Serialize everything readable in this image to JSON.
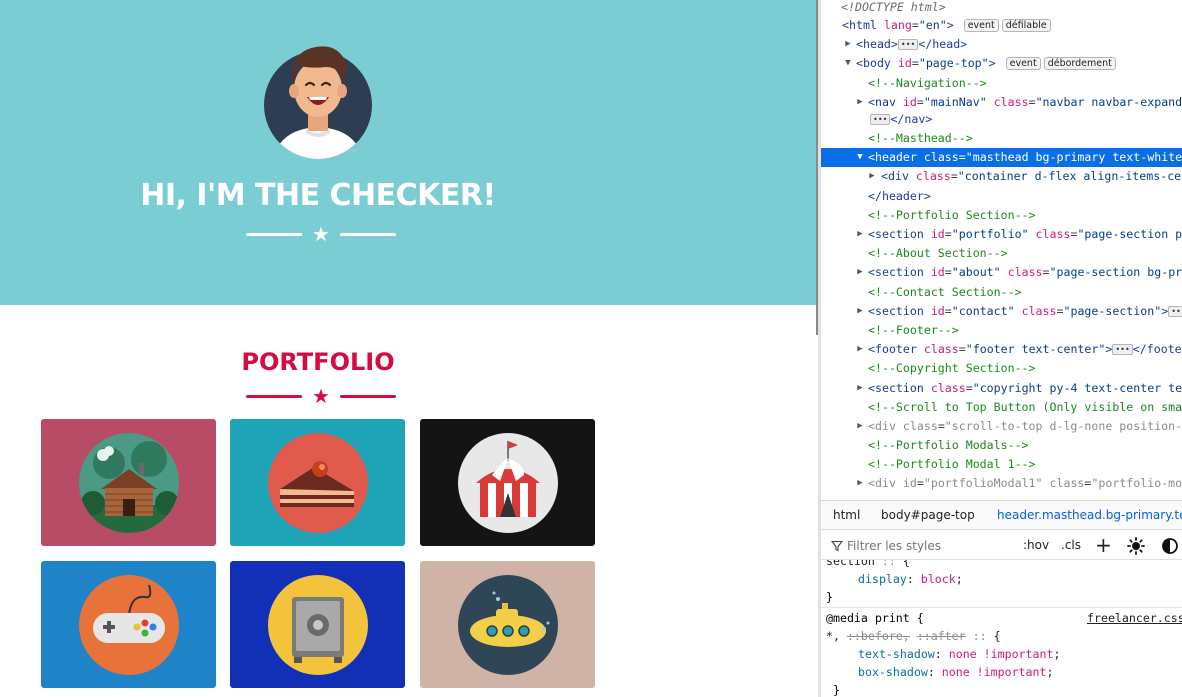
{
  "page": {
    "masthead_title": "HI, I'M THE CHECKER!",
    "portfolio_title": "PORTFOLIO",
    "colors": {
      "masthead": "#7bcdd4",
      "accent": "#d50b43"
    },
    "tiles": [
      {
        "name": "cabin",
        "bg": "#b84b65",
        "icon": "cabin-icon"
      },
      {
        "name": "cake",
        "bg": "#1fa3b7",
        "icon": "cake-icon"
      },
      {
        "name": "circus",
        "bg": "#141414",
        "icon": "circus-tent-icon"
      },
      {
        "name": "game",
        "bg": "#1f84c7",
        "icon": "game-controller-icon"
      },
      {
        "name": "safe",
        "bg": "#1230b5",
        "icon": "safe-icon"
      },
      {
        "name": "submarine",
        "bg": "#ceb3a6",
        "icon": "submarine-icon"
      }
    ]
  },
  "devtools": {
    "tree": {
      "doctype": "<!DOCTYPE html>",
      "html_open": "<html",
      "lang_attr": "lang",
      "lang_val": "\"en\"",
      "gt": ">",
      "badge_event": "event",
      "badge_scrollable": "défilable",
      "head_open": "<head>",
      "head_close": "</head>",
      "body_open": "<body",
      "body_id_attr": "id",
      "body_id_val": "\"page-top\"",
      "badge_overflow": "débordement",
      "c_nav": "<!--Navigation-->",
      "nav_open": "<nav",
      "nav_id_attr": "id",
      "nav_id_val": "\"mainNav\"",
      "nav_class_attr": "class",
      "nav_class_val": "\"navbar navbar-expand",
      "nav_close": "</nav>",
      "c_masthead": "<!--Masthead-->",
      "header_open": "<header",
      "header_class_attr": "class",
      "header_class_val": "\"masthead bg-primary text-white",
      "div_open": "<div",
      "div_class_attr": "class",
      "div_class_val": "\"container d-flex align-items-ce",
      "header_close": "</header>",
      "c_portfolio": "<!--Portfolio Section-->",
      "sec1_open": "<section",
      "sec1_id_attr": "id",
      "sec1_id_val": "\"portfolio\"",
      "sec1_class_attr": "class",
      "sec1_class_val": "\"page-section p",
      "c_about": "<!--About Section-->",
      "sec2_open": "<section",
      "sec2_id_attr": "id",
      "sec2_id_val": "\"about\"",
      "sec2_class_attr": "class",
      "sec2_class_val": "\"page-section bg-pr",
      "c_contact": "<!--Contact Section-->",
      "sec3_open": "<section",
      "sec3_id_attr": "id",
      "sec3_id_val": "\"contact\"",
      "sec3_class_attr": "class",
      "sec3_class_val": "\"page-section\"",
      "c_footer": "<!--Footer-->",
      "footer_open": "<footer",
      "footer_class_attr": "class",
      "footer_class_val": "\"footer text-center\"",
      "footer_close": "</foote",
      "c_copyright": "<!--Copyright Section-->",
      "sec4_open": "<section",
      "sec4_class_attr": "class",
      "sec4_class_val": "\"copyright py-4 text-center te",
      "c_scroll": "<!--Scroll to Top Button (Only visible on sma",
      "div2_open": "<div",
      "div2_class_attr": "class",
      "div2_class_val": "\"scroll-to-top d-lg-none position-",
      "c_modals": "<!--Portfolio Modals-->",
      "c_modal1": "<!--Portfolio Modal 1-->",
      "div3_open": "<div",
      "div3_id_attr": "id",
      "div3_id_val": "\"portfolioModal1\"",
      "div3_class_attr": "class",
      "div3_class_val": "\"portfolio-mo"
    },
    "breadcrumb": [
      "html",
      "body#page-top",
      "header.masthead.bg-primary.te"
    ],
    "filter_placeholder": "Filtrer les styles",
    "hov": ":hov",
    "cls": ".cls",
    "rules": {
      "section_selector": "section",
      "display_prop": "display",
      "display_val": "block",
      "close1": "}",
      "media": "@media print {",
      "source": "freelancer.css",
      "sel_star": "*,",
      "sel_before": "::before",
      "sel_comma": ",",
      "sel_after": "::after",
      "open2": "{",
      "ts_prop": "text-shadow",
      "ts_val": "none !important",
      "bs_prop": "box-shadow",
      "bs_val": "none !important",
      "close2": "}",
      "close3": "}"
    }
  }
}
